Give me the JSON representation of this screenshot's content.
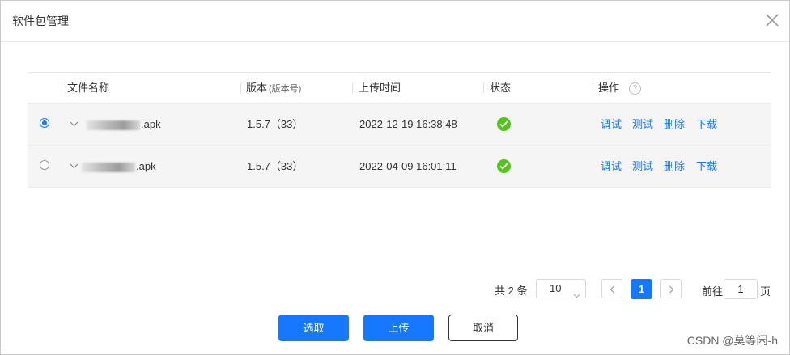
{
  "dialog": {
    "title": "软件包管理"
  },
  "table": {
    "columns": {
      "name": "文件名称",
      "version": "版本",
      "version_sub": "(版本号)",
      "upload_time": "上传时间",
      "status": "状态",
      "actions": "操作",
      "actions_help": "?"
    },
    "rows": [
      {
        "selected": true,
        "name_suffix": ".apk",
        "version": "1.5.7（33）",
        "upload_time": "2022-12-19 16:38:48",
        "status": "success"
      },
      {
        "selected": false,
        "name_suffix": ".apk",
        "version": "1.5.7（33）",
        "upload_time": "2022-04-09 16:01:11",
        "status": "success"
      }
    ],
    "row_actions": [
      "调试",
      "测试",
      "删除",
      "下载"
    ]
  },
  "pagination": {
    "total_label": "共 2 条",
    "page_size": "10",
    "current_page": "1",
    "goto_label": "前往",
    "goto_value": "1",
    "page_unit": "页"
  },
  "footer": {
    "select_label": "选取",
    "upload_label": "上传",
    "cancel_label": "取消"
  },
  "watermark": "CSDN @莫等闲-h",
  "colors": {
    "primary": "#1677ff",
    "success": "#52c41a"
  }
}
